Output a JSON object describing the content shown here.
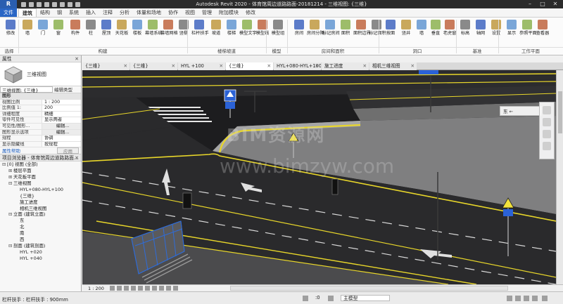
{
  "titlebar": {
    "app_button": "R",
    "title": "Autodesk Revit 2020 - 体育馆周边道路路面-20181214 - 三维视图: {三维}"
  },
  "ribbon_tabs": [
    "文件",
    "建筑",
    "结构",
    "钢",
    "系统",
    "插入",
    "注释",
    "分析",
    "体量和场地",
    "协作",
    "视图",
    "管理",
    "附加模块",
    "修改"
  ],
  "ribbon": {
    "tools": [
      {
        "label": "修改",
        "icon": "cursor-icon"
      },
      {
        "label": "墙",
        "icon": "wall-icon"
      },
      {
        "label": "门",
        "icon": "door-icon"
      },
      {
        "label": "窗",
        "icon": "window-icon"
      },
      {
        "label": "构件",
        "icon": "component-icon"
      },
      {
        "label": "柱",
        "icon": "column-icon"
      },
      {
        "label": "屋顶",
        "icon": "roof-icon"
      },
      {
        "label": "天花板",
        "icon": "ceiling-icon"
      },
      {
        "label": "楼板",
        "icon": "floor-icon"
      },
      {
        "label": "幕墙系统",
        "icon": "curtain-system-icon"
      },
      {
        "label": "幕墙网格",
        "icon": "curtain-grid-icon"
      },
      {
        "label": "竖梃",
        "icon": "mullion-icon"
      },
      {
        "label": "栏杆扶手",
        "icon": "railing-icon"
      },
      {
        "label": "坡道",
        "icon": "ramp-icon"
      },
      {
        "label": "楼梯",
        "icon": "stair-icon"
      },
      {
        "label": "模型文字",
        "icon": "model-text-icon"
      },
      {
        "label": "模型线",
        "icon": "model-line-icon"
      },
      {
        "label": "模型组",
        "icon": "model-group-icon"
      },
      {
        "label": "房间",
        "icon": "room-icon"
      },
      {
        "label": "房间分隔",
        "icon": "room-separator-icon"
      },
      {
        "label": "标记房间",
        "icon": "tag-room-icon"
      },
      {
        "label": "面积",
        "icon": "area-icon"
      },
      {
        "label": "面积边界",
        "icon": "area-boundary-icon"
      },
      {
        "label": "标记面积",
        "icon": "tag-area-icon"
      },
      {
        "label": "按面",
        "icon": "by-face-icon"
      },
      {
        "label": "竖井",
        "icon": "shaft-icon"
      },
      {
        "label": "墙",
        "icon": "wall-opening-icon"
      },
      {
        "label": "垂直",
        "icon": "vertical-icon"
      },
      {
        "label": "老虎窗",
        "icon": "dormer-icon"
      },
      {
        "label": "标高",
        "icon": "level-icon"
      },
      {
        "label": "轴网",
        "icon": "grid-icon"
      },
      {
        "label": "设置",
        "icon": "set-icon"
      },
      {
        "label": "显示",
        "icon": "show-icon"
      },
      {
        "label": "参照平面",
        "icon": "ref-plane-icon"
      },
      {
        "label": "查看器",
        "icon": "viewer-icon"
      }
    ],
    "groups": [
      "选择",
      "构建",
      "楼梯坡道",
      "模型",
      "房间和面积",
      "洞口",
      "基准",
      "工作平面"
    ]
  },
  "properties": {
    "title": "属性",
    "type_name": "三维视图",
    "view_combo": "三维视图: {三维}",
    "edit_type": "编辑类型",
    "rows": [
      {
        "k": "图形",
        "v": "",
        "cat": true
      },
      {
        "k": "视图比例",
        "v": "1 : 200"
      },
      {
        "k": "比例值 1:",
        "v": "200"
      },
      {
        "k": "详细程度",
        "v": "精细"
      },
      {
        "k": "零件可见性",
        "v": "显示两者"
      },
      {
        "k": "可见性/图形...",
        "v": "编辑...",
        "btn": true
      },
      {
        "k": "图形显示选项",
        "v": "编辑...",
        "btn": true
      },
      {
        "k": "规程",
        "v": "协调"
      },
      {
        "k": "显示隐藏线",
        "v": "按规程"
      }
    ],
    "help_link": "属性帮助",
    "apply": "应用"
  },
  "browser": {
    "title": "项目浏览器 - 体育馆周边道路路面...",
    "nodes": [
      {
        "indent": 0,
        "sym": "⊟",
        "label": "[0] 视图 (全部)"
      },
      {
        "indent": 1,
        "sym": "⊞",
        "label": "楼层平面"
      },
      {
        "indent": 1,
        "sym": "⊞",
        "label": "天花板平面"
      },
      {
        "indent": 1,
        "sym": "⊟",
        "label": "三维视图"
      },
      {
        "indent": 2,
        "sym": "",
        "label": "HYL+080-HYL+100"
      },
      {
        "indent": 2,
        "sym": "",
        "label": "{三维}"
      },
      {
        "indent": 2,
        "sym": "",
        "label": "施工进度"
      },
      {
        "indent": 2,
        "sym": "",
        "label": "相机三维视图"
      },
      {
        "indent": 1,
        "sym": "⊟",
        "label": "立面 (建筑立面)"
      },
      {
        "indent": 2,
        "sym": "",
        "label": "东"
      },
      {
        "indent": 2,
        "sym": "",
        "label": "北"
      },
      {
        "indent": 2,
        "sym": "",
        "label": "南"
      },
      {
        "indent": 2,
        "sym": "",
        "label": "西"
      },
      {
        "indent": 1,
        "sym": "⊟",
        "label": "剖面 (建筑剖面)"
      },
      {
        "indent": 2,
        "sym": "",
        "label": "HYL +020"
      },
      {
        "indent": 2,
        "sym": "",
        "label": "HYL +040"
      }
    ]
  },
  "view_tabs": [
    {
      "label": "{三维}",
      "active": false
    },
    {
      "label": "{三维}",
      "active": false
    },
    {
      "label": "HYL +100",
      "active": false
    },
    {
      "label": "{三维}",
      "active": true
    },
    {
      "label": "HYL+080-HYL+100",
      "active": false
    },
    {
      "label": "施工进度",
      "active": false
    },
    {
      "label": "相机三维视图",
      "active": false
    }
  ],
  "viewport": {
    "watermark_cn": "BIM资源网",
    "watermark_url": "www.bimzyw.com",
    "viewcube_label": "东 ←",
    "colors": {
      "asphalt": "#2a2a2c",
      "curb": "#7a7a7a",
      "yellow_line": "#e8d62a",
      "sidewalk": "#8b8b8b",
      "railing": "#2f6cd8"
    }
  },
  "viewbar": {
    "scale": "1 : 200"
  },
  "status": {
    "message": "栏杆扶手 : 栏杆扶手 : 900mm",
    "zero": ":0",
    "model": "主模型"
  }
}
